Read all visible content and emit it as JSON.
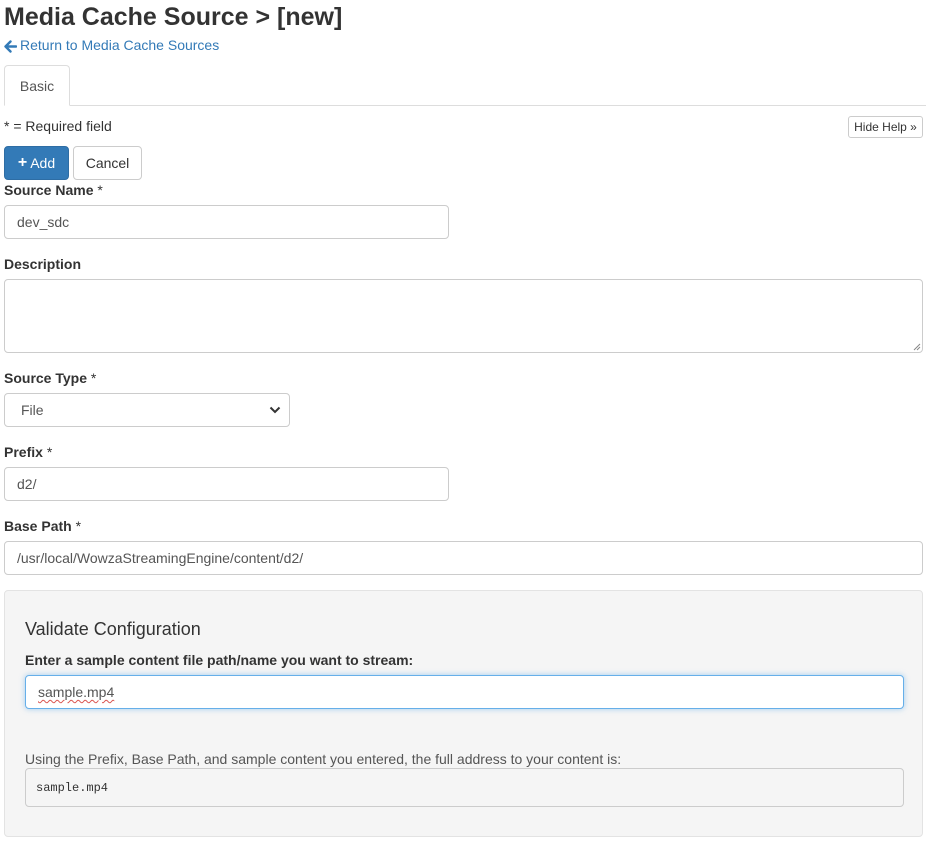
{
  "header": {
    "title": "Media Cache Source > [new]",
    "back_link": "Return to Media Cache Sources"
  },
  "tabs": [
    {
      "label": "Basic",
      "active": true
    }
  ],
  "form": {
    "required_note": "* = Required field",
    "hide_help": "Hide Help »",
    "add_button": "Add",
    "cancel_button": "Cancel",
    "source_name": {
      "label": "Source Name",
      "required_mark": "*",
      "value": "dev_sdc"
    },
    "description": {
      "label": "Description",
      "value": ""
    },
    "source_type": {
      "label": "Source Type",
      "required_mark": "*",
      "selected": "File"
    },
    "prefix": {
      "label": "Prefix",
      "required_mark": "*",
      "value": "d2/"
    },
    "base_path": {
      "label": "Base Path",
      "required_mark": "*",
      "value": "/usr/local/WowzaStreamingEngine/content/d2/"
    }
  },
  "validate": {
    "title": "Validate Configuration",
    "sample_label": "Enter a sample content file path/name you want to stream:",
    "sample_value": "sample.mp4",
    "help_text": "Using the Prefix, Base Path, and sample content you entered, the full address to your content is:",
    "full_address": "sample.mp4"
  },
  "colors": {
    "link": "#337ab7",
    "primary_button": "#337ab7",
    "panel_bg": "#f5f5f5",
    "focus_border": "#66afe9"
  },
  "icons": [
    "arrow-left-icon",
    "plus-icon",
    "chevron-down-icon"
  ]
}
